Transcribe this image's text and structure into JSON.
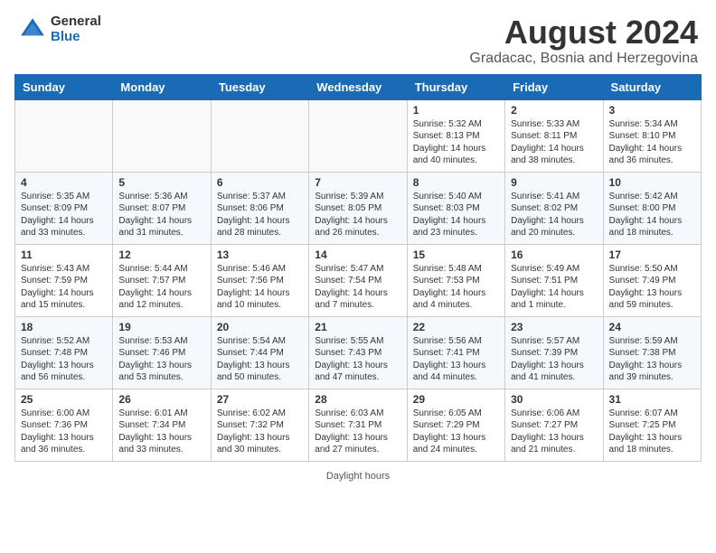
{
  "header": {
    "logo_general": "General",
    "logo_blue": "Blue",
    "month_title": "August 2024",
    "location": "Gradacac, Bosnia and Herzegovina"
  },
  "calendar": {
    "days_of_week": [
      "Sunday",
      "Monday",
      "Tuesday",
      "Wednesday",
      "Thursday",
      "Friday",
      "Saturday"
    ],
    "footer": "Daylight hours",
    "weeks": [
      [
        {
          "day": "",
          "content": ""
        },
        {
          "day": "",
          "content": ""
        },
        {
          "day": "",
          "content": ""
        },
        {
          "day": "",
          "content": ""
        },
        {
          "day": "1",
          "content": "Sunrise: 5:32 AM\nSunset: 8:13 PM\nDaylight: 14 hours\nand 40 minutes."
        },
        {
          "day": "2",
          "content": "Sunrise: 5:33 AM\nSunset: 8:11 PM\nDaylight: 14 hours\nand 38 minutes."
        },
        {
          "day": "3",
          "content": "Sunrise: 5:34 AM\nSunset: 8:10 PM\nDaylight: 14 hours\nand 36 minutes."
        }
      ],
      [
        {
          "day": "4",
          "content": "Sunrise: 5:35 AM\nSunset: 8:09 PM\nDaylight: 14 hours\nand 33 minutes."
        },
        {
          "day": "5",
          "content": "Sunrise: 5:36 AM\nSunset: 8:07 PM\nDaylight: 14 hours\nand 31 minutes."
        },
        {
          "day": "6",
          "content": "Sunrise: 5:37 AM\nSunset: 8:06 PM\nDaylight: 14 hours\nand 28 minutes."
        },
        {
          "day": "7",
          "content": "Sunrise: 5:39 AM\nSunset: 8:05 PM\nDaylight: 14 hours\nand 26 minutes."
        },
        {
          "day": "8",
          "content": "Sunrise: 5:40 AM\nSunset: 8:03 PM\nDaylight: 14 hours\nand 23 minutes."
        },
        {
          "day": "9",
          "content": "Sunrise: 5:41 AM\nSunset: 8:02 PM\nDaylight: 14 hours\nand 20 minutes."
        },
        {
          "day": "10",
          "content": "Sunrise: 5:42 AM\nSunset: 8:00 PM\nDaylight: 14 hours\nand 18 minutes."
        }
      ],
      [
        {
          "day": "11",
          "content": "Sunrise: 5:43 AM\nSunset: 7:59 PM\nDaylight: 14 hours\nand 15 minutes."
        },
        {
          "day": "12",
          "content": "Sunrise: 5:44 AM\nSunset: 7:57 PM\nDaylight: 14 hours\nand 12 minutes."
        },
        {
          "day": "13",
          "content": "Sunrise: 5:46 AM\nSunset: 7:56 PM\nDaylight: 14 hours\nand 10 minutes."
        },
        {
          "day": "14",
          "content": "Sunrise: 5:47 AM\nSunset: 7:54 PM\nDaylight: 14 hours\nand 7 minutes."
        },
        {
          "day": "15",
          "content": "Sunrise: 5:48 AM\nSunset: 7:53 PM\nDaylight: 14 hours\nand 4 minutes."
        },
        {
          "day": "16",
          "content": "Sunrise: 5:49 AM\nSunset: 7:51 PM\nDaylight: 14 hours\nand 1 minute."
        },
        {
          "day": "17",
          "content": "Sunrise: 5:50 AM\nSunset: 7:49 PM\nDaylight: 13 hours\nand 59 minutes."
        }
      ],
      [
        {
          "day": "18",
          "content": "Sunrise: 5:52 AM\nSunset: 7:48 PM\nDaylight: 13 hours\nand 56 minutes."
        },
        {
          "day": "19",
          "content": "Sunrise: 5:53 AM\nSunset: 7:46 PM\nDaylight: 13 hours\nand 53 minutes."
        },
        {
          "day": "20",
          "content": "Sunrise: 5:54 AM\nSunset: 7:44 PM\nDaylight: 13 hours\nand 50 minutes."
        },
        {
          "day": "21",
          "content": "Sunrise: 5:55 AM\nSunset: 7:43 PM\nDaylight: 13 hours\nand 47 minutes."
        },
        {
          "day": "22",
          "content": "Sunrise: 5:56 AM\nSunset: 7:41 PM\nDaylight: 13 hours\nand 44 minutes."
        },
        {
          "day": "23",
          "content": "Sunrise: 5:57 AM\nSunset: 7:39 PM\nDaylight: 13 hours\nand 41 minutes."
        },
        {
          "day": "24",
          "content": "Sunrise: 5:59 AM\nSunset: 7:38 PM\nDaylight: 13 hours\nand 39 minutes."
        }
      ],
      [
        {
          "day": "25",
          "content": "Sunrise: 6:00 AM\nSunset: 7:36 PM\nDaylight: 13 hours\nand 36 minutes."
        },
        {
          "day": "26",
          "content": "Sunrise: 6:01 AM\nSunset: 7:34 PM\nDaylight: 13 hours\nand 33 minutes."
        },
        {
          "day": "27",
          "content": "Sunrise: 6:02 AM\nSunset: 7:32 PM\nDaylight: 13 hours\nand 30 minutes."
        },
        {
          "day": "28",
          "content": "Sunrise: 6:03 AM\nSunset: 7:31 PM\nDaylight: 13 hours\nand 27 minutes."
        },
        {
          "day": "29",
          "content": "Sunrise: 6:05 AM\nSunset: 7:29 PM\nDaylight: 13 hours\nand 24 minutes."
        },
        {
          "day": "30",
          "content": "Sunrise: 6:06 AM\nSunset: 7:27 PM\nDaylight: 13 hours\nand 21 minutes."
        },
        {
          "day": "31",
          "content": "Sunrise: 6:07 AM\nSunset: 7:25 PM\nDaylight: 13 hours\nand 18 minutes."
        }
      ]
    ]
  }
}
